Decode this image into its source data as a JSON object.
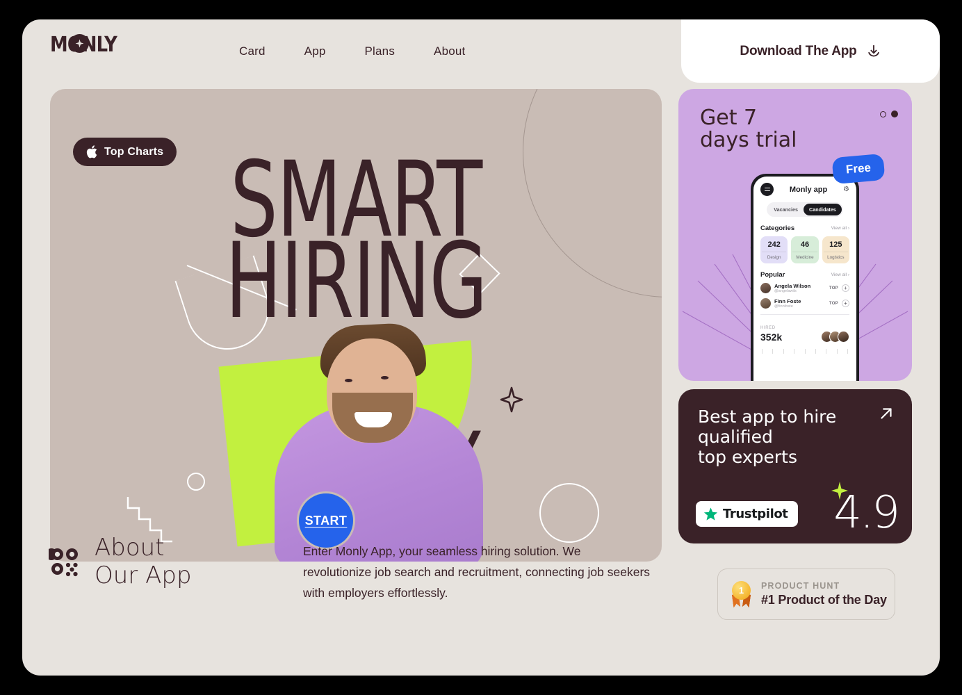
{
  "brand": {
    "name": "MONLY",
    "logo_icon": "sparkle-in-circle-icon"
  },
  "header": {
    "nav": [
      {
        "label": "Card"
      },
      {
        "label": "App"
      },
      {
        "label": "Plans"
      },
      {
        "label": "About"
      }
    ],
    "download": {
      "label": "Download The App",
      "icon": "download-icon"
    }
  },
  "hero": {
    "top_charts": {
      "label": "Top Charts",
      "icon": "apple-icon"
    },
    "headline_line1": "SMART",
    "headline_line2": "HIRING",
    "headline_line3": "TODAY",
    "start_button": "START"
  },
  "trial": {
    "title_line1": "Get 7",
    "title_line2": "days trial",
    "badge": "Free",
    "phone": {
      "app_title": "Monly app",
      "menu_icon": "hamburger-icon",
      "settings_icon": "gear-icon",
      "tabs": [
        {
          "label": "Vacancies",
          "active": false
        },
        {
          "label": "Candidates",
          "active": true
        }
      ],
      "categories_heading": "Categories",
      "categories_view_all": "View all ›",
      "categories": [
        {
          "count": "242",
          "label": "Design",
          "color": "#e2def7"
        },
        {
          "count": "46",
          "label": "Medicine",
          "color": "#d7edd9"
        },
        {
          "count": "125",
          "label": "Logistics",
          "color": "#f6e6cc"
        }
      ],
      "popular_heading": "Popular",
      "popular_view_all": "View all ›",
      "popular": [
        {
          "name": "Angela Wilson",
          "handle": "@angelawils",
          "tag": "TOP",
          "action": "+"
        },
        {
          "name": "Finn Foste",
          "handle": "@finnfoste",
          "tag": "TOP",
          "action": "+"
        }
      ],
      "hired_label": "HIRED",
      "hired_value": "352k"
    }
  },
  "trust": {
    "title_line1": "Best app to hire",
    "title_line2": "qualified",
    "title_line3": "top experts",
    "link_icon": "arrow-up-right-icon",
    "brand": "Trustpilot",
    "score": "4.9"
  },
  "about": {
    "icon": "qr-grid-icon",
    "title_line1": "About",
    "title_line2": "Our App",
    "body": "Enter Monly App, your seamless hiring solution. We revolutionize job search and recruitment, connecting job seekers with employers effortlessly."
  },
  "product_hunt": {
    "label": "PRODUCT HUNT",
    "value": "#1 Product of the Day",
    "icon": "gold-medal-icon",
    "medal_number": "1"
  },
  "colors": {
    "page_bg": "#e7e3de",
    "hero_bg": "#c9bcb5",
    "dark": "#3a2228",
    "lime": "#c2f03f",
    "purple": "#cda7e3",
    "blue": "#2563eb",
    "trustpilot_green": "#00b67a"
  }
}
